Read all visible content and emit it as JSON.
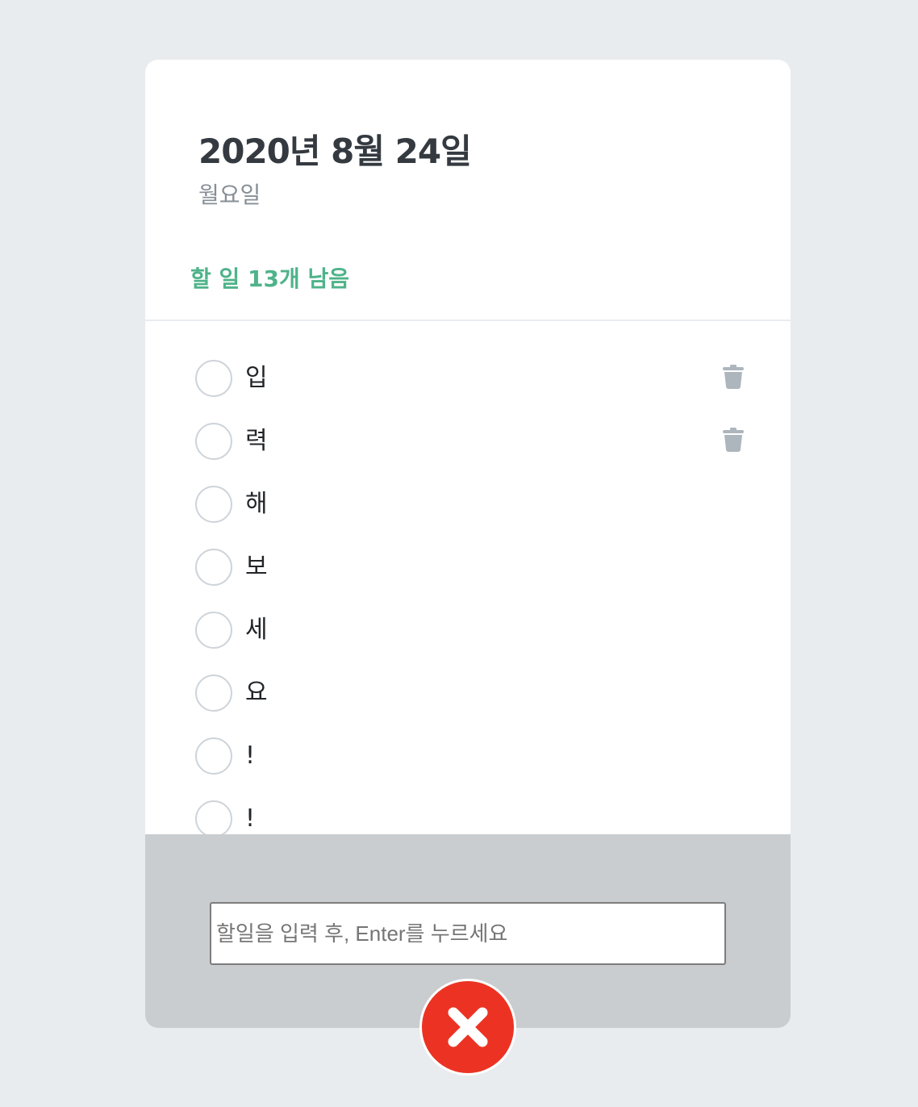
{
  "header": {
    "date": "2020년 8월 24일",
    "day": "월요일",
    "tasks_left": "할 일 13개 남음"
  },
  "todos": [
    {
      "text": "입",
      "done": false,
      "show_delete": true
    },
    {
      "text": "력",
      "done": false,
      "show_delete": true
    },
    {
      "text": "해",
      "done": false,
      "show_delete": false
    },
    {
      "text": "보",
      "done": false,
      "show_delete": false
    },
    {
      "text": "세",
      "done": false,
      "show_delete": false
    },
    {
      "text": "요",
      "done": false,
      "show_delete": false
    },
    {
      "text": "!",
      "done": false,
      "show_delete": false
    },
    {
      "text": "!",
      "done": false,
      "show_delete": false
    }
  ],
  "create": {
    "placeholder": "할일을 입력 후, Enter를 누르세요",
    "value": ""
  },
  "colors": {
    "accent": "#4fb38a",
    "close_button": "#ec3323",
    "footer_bg": "#c9cdcf",
    "page_bg": "#e9ecef"
  },
  "icons": {
    "delete": "trash-icon",
    "close": "close-x-icon"
  }
}
